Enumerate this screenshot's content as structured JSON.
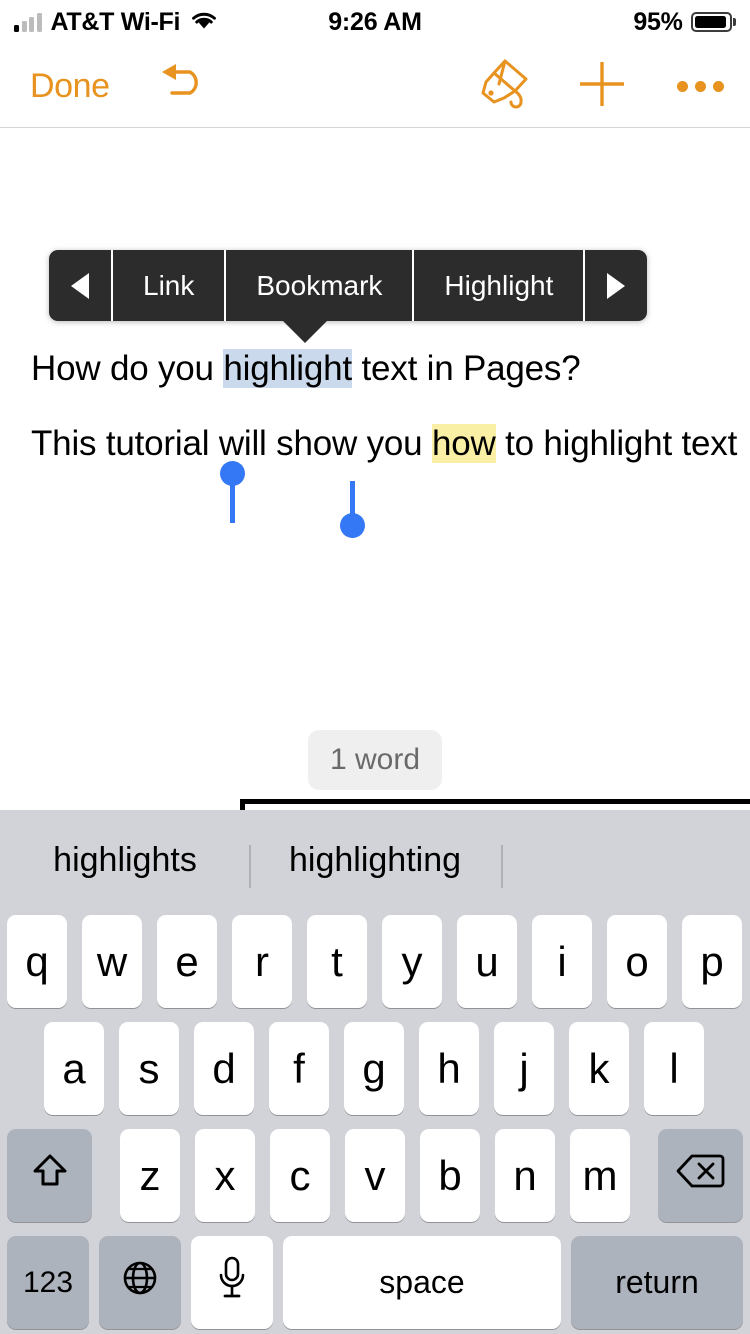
{
  "status_bar": {
    "carrier": "AT&T Wi-Fi",
    "time": "9:26 AM",
    "battery_percent": "95%",
    "signal_bars_filled": 1,
    "signal_bars_total": 4,
    "wifi_icon": "wifi-icon",
    "battery_icon": "battery-icon"
  },
  "toolbar": {
    "done_label": "Done",
    "undo_icon": "undo-arrow-icon",
    "format_icon": "paintbrush-icon",
    "add_icon": "plus-icon",
    "more_icon": "ellipsis-icon",
    "accent_color": "#E8921F"
  },
  "context_menu": {
    "prev_icon": "triangle-left-icon",
    "next_icon": "triangle-right-icon",
    "items": [
      {
        "label": "Link"
      },
      {
        "label": "Bookmark"
      },
      {
        "label": "Highlight"
      }
    ],
    "background_color": "#2C2C2C",
    "pointer_target": "Bookmark"
  },
  "document": {
    "line1": {
      "before": "How do you ",
      "selected": "highlight",
      "after": " text in Pages?"
    },
    "line2": {
      "before": "This tutorial will show you ",
      "highlighted": "how",
      "after": " to highlight text"
    },
    "selection_color": "#CBD9EC",
    "highlight_color": "#FAF0A5",
    "handle_color": "#3478F6"
  },
  "word_count": {
    "label": "1 word"
  },
  "keyboard": {
    "suggestions": [
      "highlights",
      "highlighting"
    ],
    "rows": [
      [
        "q",
        "w",
        "e",
        "r",
        "t",
        "y",
        "u",
        "i",
        "o",
        "p"
      ],
      [
        "a",
        "s",
        "d",
        "f",
        "g",
        "h",
        "j",
        "k",
        "l"
      ],
      [
        "z",
        "x",
        "c",
        "v",
        "b",
        "n",
        "m"
      ]
    ],
    "shift_icon": "shift-up-arrow-icon",
    "backspace_icon": "backspace-delete-icon",
    "numbers_label": "123",
    "globe_icon": "globe-language-icon",
    "mic_icon": "microphone-icon",
    "space_label": "space",
    "return_label": "return",
    "background_color": "#D1D3D9",
    "key_color": "#FFFFFF",
    "modifier_key_color": "#ADB3BD"
  }
}
